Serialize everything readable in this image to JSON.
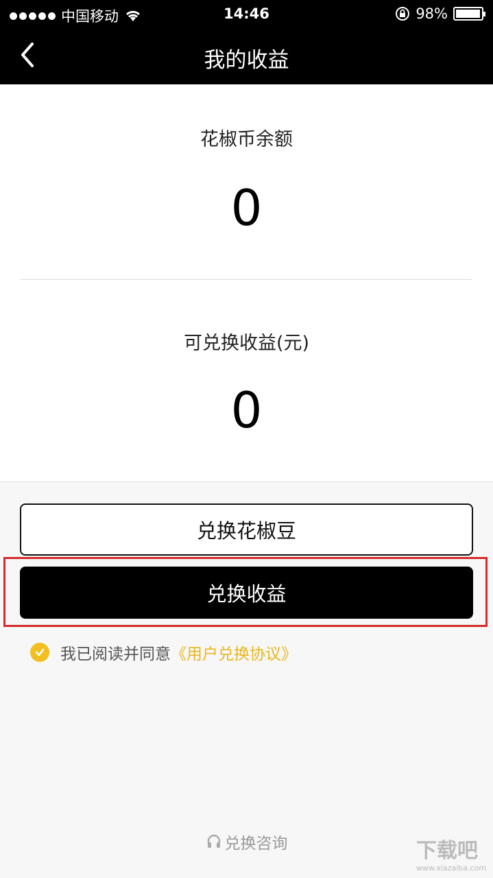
{
  "status": {
    "carrier": "中国移动",
    "time": "14:46",
    "battery": "98%",
    "battery_level": 0.98
  },
  "nav": {
    "title": "我的收益",
    "back_icon": "chevron-left-icon"
  },
  "balance": {
    "label": "花椒币余额",
    "value": "0"
  },
  "earnings": {
    "label": "可兑换收益(元)",
    "value": "0"
  },
  "buttons": {
    "exchange_beans": "兑换花椒豆",
    "exchange_earnings": "兑换收益"
  },
  "agreement": {
    "text": "我已阅读并同意",
    "link": "《用户兑换协议》",
    "checked": true
  },
  "footer": {
    "consult": "兑换咨询",
    "watermark": "下载吧",
    "watermark_url": "www.xiazaiba.com"
  },
  "colors": {
    "accent": "#f3be1f",
    "highlight_border": "#d42a2a",
    "bar": "#000000"
  }
}
